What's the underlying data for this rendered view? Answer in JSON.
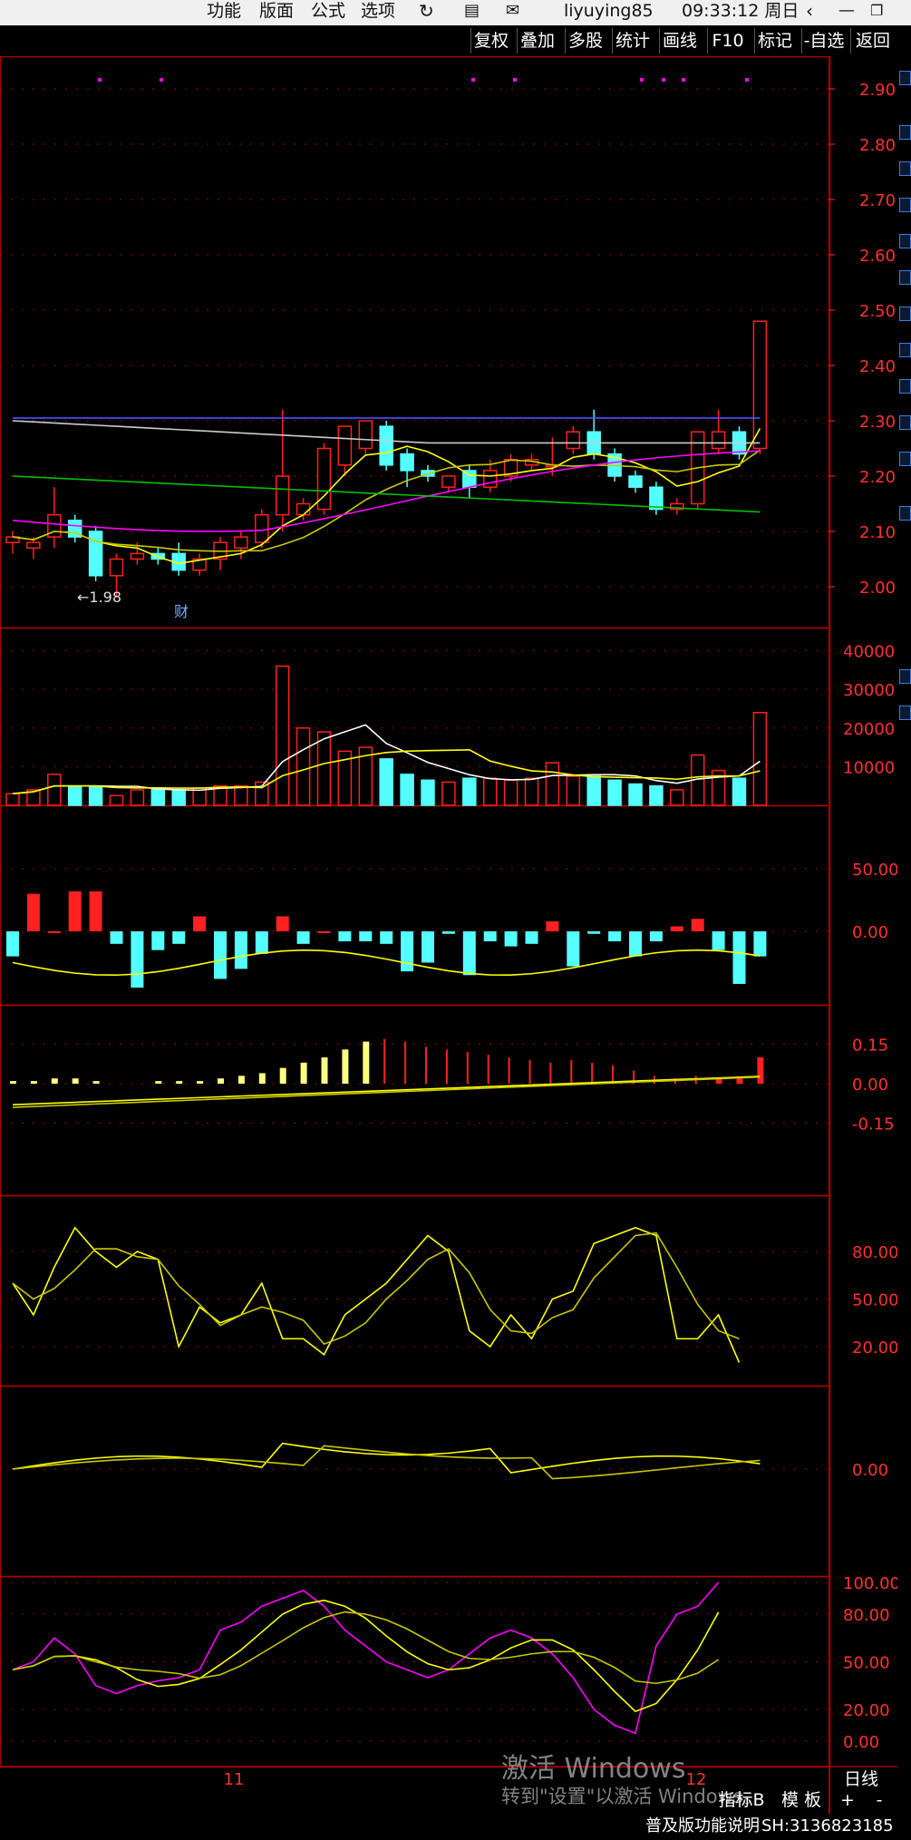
{
  "menu": [
    "功能",
    "版面",
    "公式",
    "选项"
  ],
  "user": "liyuying85",
  "clock": "09:33:12 周日",
  "toolbar_buttons": [
    "复权",
    "叠加",
    "多股",
    "统计",
    "画线",
    "F10",
    "标记",
    "-自选",
    "返回"
  ],
  "price_axis": [
    "2.90",
    "2.80",
    "2.70",
    "2.60",
    "2.50",
    "2.40",
    "2.30",
    "2.20",
    "2.10",
    "2.00"
  ],
  "volume_axis": [
    "40000",
    "30000",
    "20000",
    "10000"
  ],
  "macd_axis": [
    "50.00",
    "0.00"
  ],
  "dma_axis": [
    "0.15",
    "0.00",
    "-0.15"
  ],
  "kdj_axis": [
    "80.00",
    "50.00",
    "20.00"
  ],
  "trix_axis": [
    "0.00"
  ],
  "rsi_axis": [
    "100.00",
    "80.00",
    "50.00",
    "20.00",
    "0.00"
  ],
  "low_marker": "←1.98",
  "finance_marker": "财",
  "x_axis": [
    "11",
    "12"
  ],
  "period": "日线",
  "watermark": {
    "title": "激活 Windows",
    "subtitle": "转到\"设置\"以激活 Windows。"
  },
  "bottom": {
    "indicator": "指标B",
    "template": "模 板",
    "plus": "+",
    "minus": "-"
  },
  "status": {
    "help": "普及版功能说明",
    "code": "SH:3136823185"
  },
  "colors": {
    "up": "#ff2020",
    "down": "#54ffff",
    "grid": "#a80000",
    "axis_text": "#ff3030",
    "ma1": "#ffffff",
    "ma2": "#ffff00",
    "ma3": "#ff00ff",
    "ma4": "#00c000",
    "ma5": "#5050ff"
  }
}
